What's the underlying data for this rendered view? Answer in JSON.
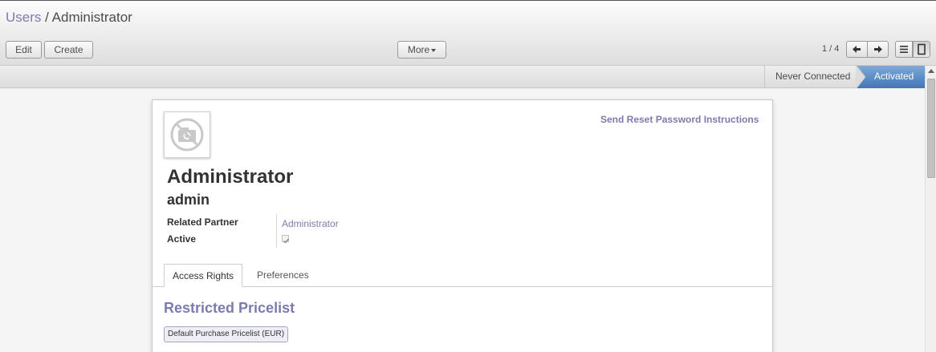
{
  "breadcrumb": {
    "parent": "Users",
    "separator": "/",
    "current": "Administrator"
  },
  "toolbar": {
    "edit_label": "Edit",
    "create_label": "Create",
    "more_label": "More"
  },
  "pager": {
    "value": "1 / 4"
  },
  "status": {
    "stages": [
      "Never Connected",
      "Activated"
    ],
    "current": "Activated"
  },
  "form": {
    "reset_link": "Send Reset Password Instructions",
    "name": "Administrator",
    "login": "admin",
    "related_partner_label": "Related Partner",
    "related_partner_value": "Administrator",
    "active_label": "Active",
    "active_checked": true
  },
  "tabs": [
    {
      "label": "Access Rights",
      "active": true
    },
    {
      "label": "Preferences",
      "active": false
    }
  ],
  "access_rights": {
    "section_title": "Restricted Pricelist",
    "tags": [
      "Default Purchase Pricelist (EUR)"
    ]
  },
  "icons": [
    "camera-placeholder-icon",
    "arrow-left-icon",
    "arrow-right-icon",
    "list-view-icon",
    "form-view-icon",
    "caret-down-icon",
    "checkbox-icon"
  ],
  "colors": {
    "link": "#7c7bad",
    "status_active": "#3f77b8"
  }
}
